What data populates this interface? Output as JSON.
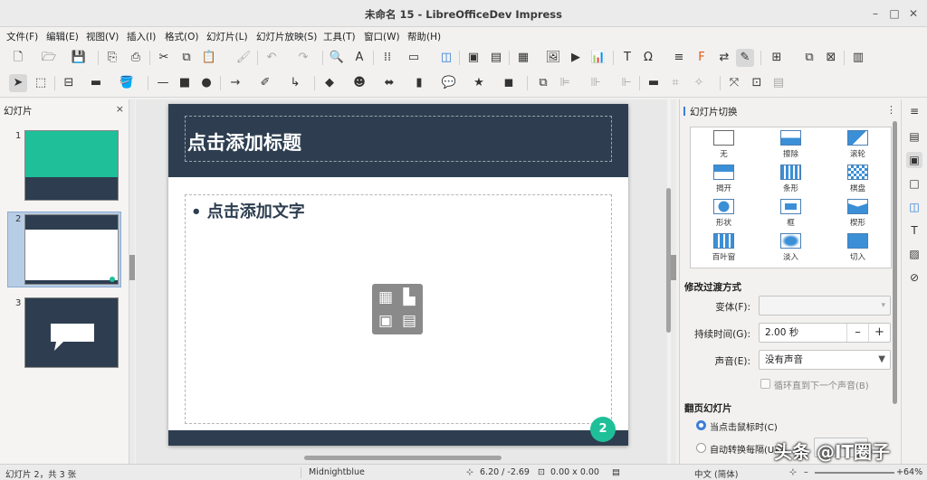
{
  "window": {
    "title": "未命名 15 - LibreOfficeDev Impress",
    "minimize": "–",
    "maximize": "□",
    "close": "✕"
  },
  "menu": [
    "文件(F)",
    "编辑(E)",
    "视图(V)",
    "插入(I)",
    "格式(O)",
    "幻灯片(L)",
    "幻灯片放映(S)",
    "工具(T)",
    "窗口(W)",
    "帮助(H)"
  ],
  "slides_pane": {
    "title": "幻灯片",
    "close": "×",
    "slides": [
      {
        "number": "1"
      },
      {
        "number": "2",
        "selected": true
      },
      {
        "number": "3"
      }
    ]
  },
  "slide": {
    "title_placeholder": "点击添加标题",
    "body_placeholder": "• 点击添加文字",
    "page_number": "2",
    "colors": {
      "band": "#2e3e50",
      "accent": "#1fbf99"
    }
  },
  "deck": {
    "title": "幻灯片切换",
    "menu": "⋮",
    "transitions": [
      {
        "label": "无"
      },
      {
        "label": "擦除"
      },
      {
        "label": "滚轮"
      },
      {
        "label": "揭开"
      },
      {
        "label": "条形"
      },
      {
        "label": "棋盘"
      },
      {
        "label": "形状"
      },
      {
        "label": "框"
      },
      {
        "label": "楔形"
      },
      {
        "label": "百叶窗"
      },
      {
        "label": "淡入"
      },
      {
        "label": "切入"
      }
    ],
    "modify": {
      "title": "修改过渡方式",
      "variant_label": "变体(F):",
      "variant_value": "",
      "duration_label": "持续时间(G):",
      "duration_value": "2.00 秒",
      "minus": "–",
      "plus": "+",
      "sound_label": "声音(E):",
      "sound_value": "没有声音",
      "loop_label": "循环直到下一个声音(B)"
    },
    "advance": {
      "title": "翻页幻灯片",
      "on_click": "当点击鼠标时(C)",
      "auto": "自动转换每隔(U)"
    }
  },
  "status": {
    "slide_info": "幻灯片 2，共 3 张",
    "master": "Midnightblue",
    "position": "6.20 / -2.69",
    "size": "0.00 x 0.00",
    "language": "中文 (简体)",
    "zoom": "64%"
  },
  "watermark": "头条 @IT圈子"
}
